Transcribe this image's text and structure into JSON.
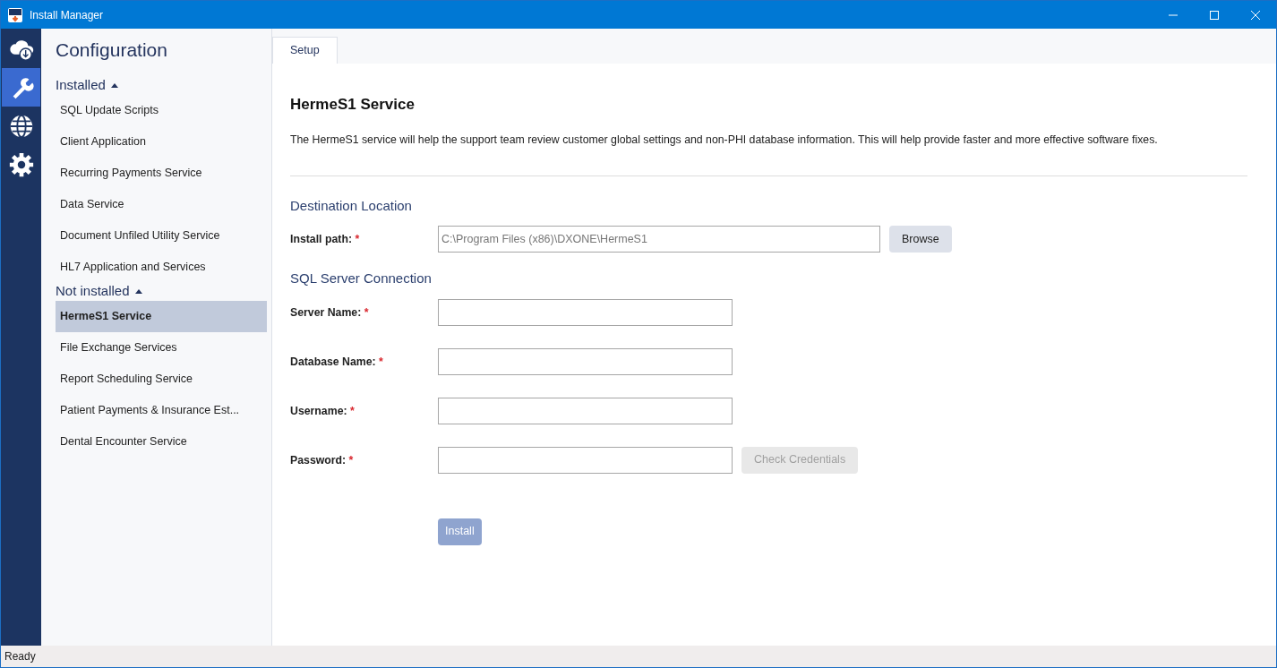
{
  "window": {
    "title": "Install Manager"
  },
  "rail": [
    {
      "kind": "cloud-download",
      "selected": false
    },
    {
      "kind": "wrench",
      "selected": true
    },
    {
      "kind": "globe",
      "selected": false
    },
    {
      "kind": "gear",
      "selected": false
    }
  ],
  "sidebar": {
    "title": "Configuration",
    "groups": [
      {
        "label": "Installed",
        "expanded": true,
        "items": [
          {
            "label": "SQL Update Scripts",
            "selected": false
          },
          {
            "label": "Client Application",
            "selected": false
          },
          {
            "label": "Recurring Payments Service",
            "selected": false
          },
          {
            "label": "Data Service",
            "selected": false
          },
          {
            "label": "Document Unfiled Utility Service",
            "selected": false
          },
          {
            "label": "HL7 Application and Services",
            "selected": false
          }
        ]
      },
      {
        "label": "Not installed",
        "expanded": true,
        "items": [
          {
            "label": "HermeS1 Service",
            "selected": true
          },
          {
            "label": "File Exchange Services",
            "selected": false
          },
          {
            "label": "Report Scheduling Service",
            "selected": false
          },
          {
            "label": "Patient Payments & Insurance Est...",
            "selected": false
          },
          {
            "label": "Dental Encounter Service",
            "selected": false
          }
        ]
      }
    ]
  },
  "tabs": [
    {
      "label": "Setup",
      "selected": true
    }
  ],
  "content": {
    "heading": "HermeS1 Service",
    "description": "The HermeS1 service will help the support team review customer global settings and non-PHI database information. This will help provide faster and more effective software fixes.",
    "sections": [
      {
        "title": "Destination Location",
        "fields": [
          {
            "label": "Install path:",
            "required_mark": "*",
            "value": "C:\\Program Files (x86)\\DXONE\\HermeS1",
            "wide": true,
            "action": {
              "label": "Browse",
              "disabled": false
            }
          }
        ]
      },
      {
        "title": "SQL Server Connection",
        "fields": [
          {
            "label": "Server Name:",
            "required_mark": "*"
          },
          {
            "label": "Database Name:",
            "required_mark": "*"
          },
          {
            "label": "Username:",
            "required_mark": "*"
          },
          {
            "label": "Password:",
            "required_mark": "*",
            "action": {
              "label": "Check Credentials",
              "disabled": true
            }
          }
        ]
      }
    ],
    "submit": {
      "label": "Install",
      "disabled": true
    }
  },
  "status_bar": {
    "text": "Ready"
  }
}
